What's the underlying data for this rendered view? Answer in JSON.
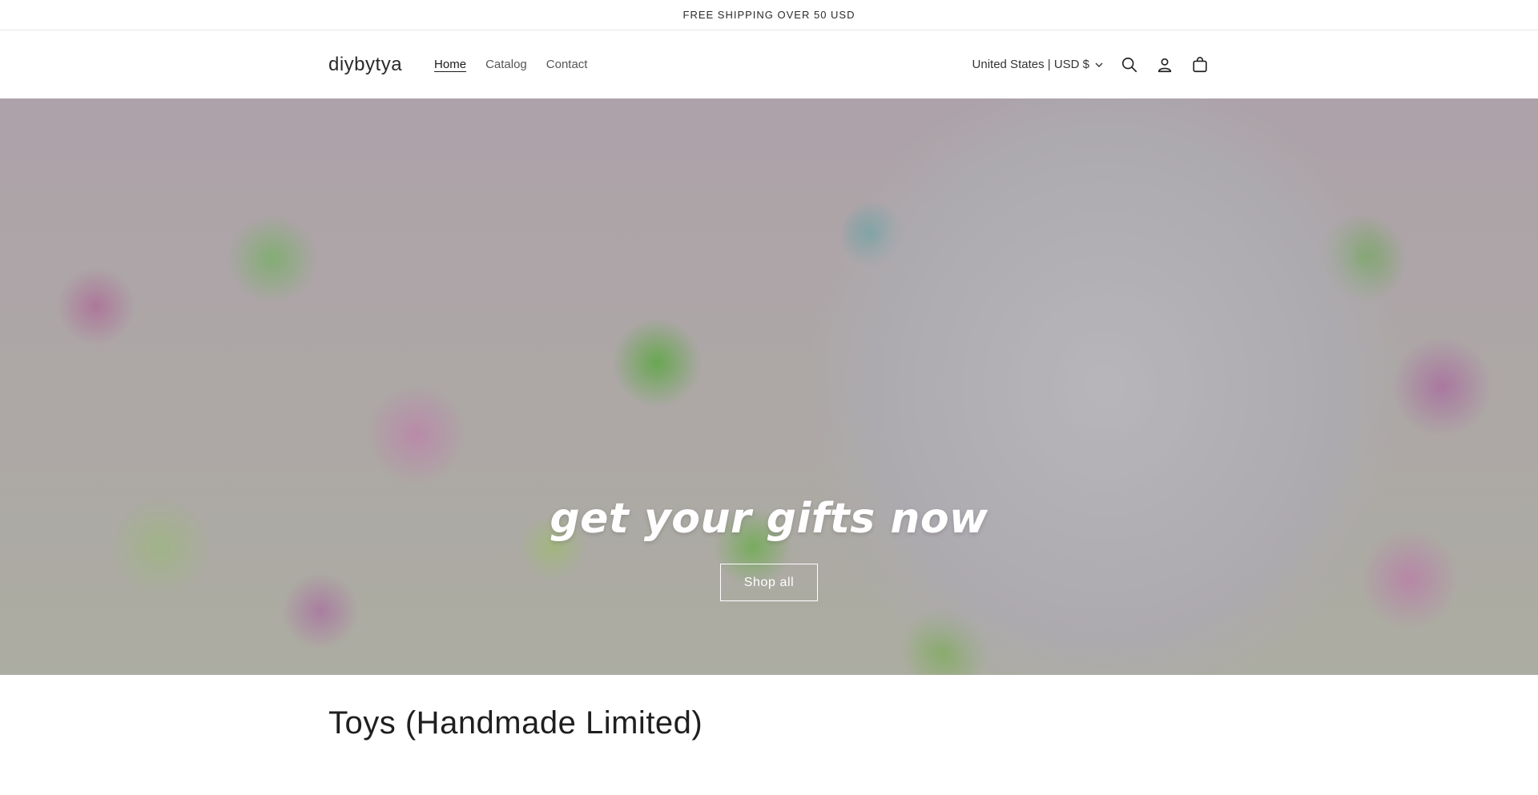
{
  "announcement": {
    "text": "FREE SHIPPING OVER 50 USD"
  },
  "header": {
    "logo": "diybytya",
    "nav": [
      {
        "label": "Home",
        "active": true
      },
      {
        "label": "Catalog",
        "active": false
      },
      {
        "label": "Contact",
        "active": false
      }
    ],
    "country_selector": "United States | USD $",
    "icons": [
      "search-icon",
      "account-icon",
      "cart-icon"
    ]
  },
  "hero": {
    "title": "get your gifts now",
    "button_label": "Shop all"
  },
  "collection": {
    "title": "Toys (Handmade Limited)"
  }
}
